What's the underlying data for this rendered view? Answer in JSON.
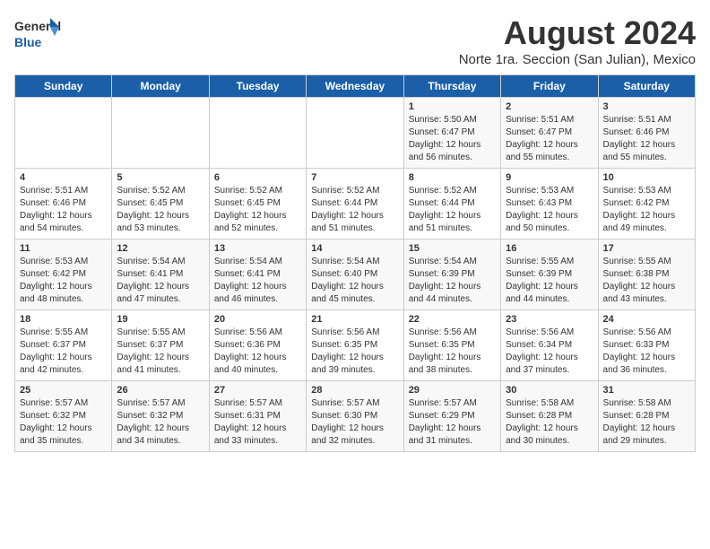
{
  "header": {
    "logo_line1": "General",
    "logo_line2": "Blue",
    "title": "August 2024",
    "subtitle": "Norte 1ra. Seccion (San Julian), Mexico"
  },
  "weekdays": [
    "Sunday",
    "Monday",
    "Tuesday",
    "Wednesday",
    "Thursday",
    "Friday",
    "Saturday"
  ],
  "weeks": [
    [
      {
        "day": "",
        "info": ""
      },
      {
        "day": "",
        "info": ""
      },
      {
        "day": "",
        "info": ""
      },
      {
        "day": "",
        "info": ""
      },
      {
        "day": "1",
        "info": "Sunrise: 5:50 AM\nSunset: 6:47 PM\nDaylight: 12 hours\nand 56 minutes."
      },
      {
        "day": "2",
        "info": "Sunrise: 5:51 AM\nSunset: 6:47 PM\nDaylight: 12 hours\nand 55 minutes."
      },
      {
        "day": "3",
        "info": "Sunrise: 5:51 AM\nSunset: 6:46 PM\nDaylight: 12 hours\nand 55 minutes."
      }
    ],
    [
      {
        "day": "4",
        "info": "Sunrise: 5:51 AM\nSunset: 6:46 PM\nDaylight: 12 hours\nand 54 minutes."
      },
      {
        "day": "5",
        "info": "Sunrise: 5:52 AM\nSunset: 6:45 PM\nDaylight: 12 hours\nand 53 minutes."
      },
      {
        "day": "6",
        "info": "Sunrise: 5:52 AM\nSunset: 6:45 PM\nDaylight: 12 hours\nand 52 minutes."
      },
      {
        "day": "7",
        "info": "Sunrise: 5:52 AM\nSunset: 6:44 PM\nDaylight: 12 hours\nand 51 minutes."
      },
      {
        "day": "8",
        "info": "Sunrise: 5:52 AM\nSunset: 6:44 PM\nDaylight: 12 hours\nand 51 minutes."
      },
      {
        "day": "9",
        "info": "Sunrise: 5:53 AM\nSunset: 6:43 PM\nDaylight: 12 hours\nand 50 minutes."
      },
      {
        "day": "10",
        "info": "Sunrise: 5:53 AM\nSunset: 6:42 PM\nDaylight: 12 hours\nand 49 minutes."
      }
    ],
    [
      {
        "day": "11",
        "info": "Sunrise: 5:53 AM\nSunset: 6:42 PM\nDaylight: 12 hours\nand 48 minutes."
      },
      {
        "day": "12",
        "info": "Sunrise: 5:54 AM\nSunset: 6:41 PM\nDaylight: 12 hours\nand 47 minutes."
      },
      {
        "day": "13",
        "info": "Sunrise: 5:54 AM\nSunset: 6:41 PM\nDaylight: 12 hours\nand 46 minutes."
      },
      {
        "day": "14",
        "info": "Sunrise: 5:54 AM\nSunset: 6:40 PM\nDaylight: 12 hours\nand 45 minutes."
      },
      {
        "day": "15",
        "info": "Sunrise: 5:54 AM\nSunset: 6:39 PM\nDaylight: 12 hours\nand 44 minutes."
      },
      {
        "day": "16",
        "info": "Sunrise: 5:55 AM\nSunset: 6:39 PM\nDaylight: 12 hours\nand 44 minutes."
      },
      {
        "day": "17",
        "info": "Sunrise: 5:55 AM\nSunset: 6:38 PM\nDaylight: 12 hours\nand 43 minutes."
      }
    ],
    [
      {
        "day": "18",
        "info": "Sunrise: 5:55 AM\nSunset: 6:37 PM\nDaylight: 12 hours\nand 42 minutes."
      },
      {
        "day": "19",
        "info": "Sunrise: 5:55 AM\nSunset: 6:37 PM\nDaylight: 12 hours\nand 41 minutes."
      },
      {
        "day": "20",
        "info": "Sunrise: 5:56 AM\nSunset: 6:36 PM\nDaylight: 12 hours\nand 40 minutes."
      },
      {
        "day": "21",
        "info": "Sunrise: 5:56 AM\nSunset: 6:35 PM\nDaylight: 12 hours\nand 39 minutes."
      },
      {
        "day": "22",
        "info": "Sunrise: 5:56 AM\nSunset: 6:35 PM\nDaylight: 12 hours\nand 38 minutes."
      },
      {
        "day": "23",
        "info": "Sunrise: 5:56 AM\nSunset: 6:34 PM\nDaylight: 12 hours\nand 37 minutes."
      },
      {
        "day": "24",
        "info": "Sunrise: 5:56 AM\nSunset: 6:33 PM\nDaylight: 12 hours\nand 36 minutes."
      }
    ],
    [
      {
        "day": "25",
        "info": "Sunrise: 5:57 AM\nSunset: 6:32 PM\nDaylight: 12 hours\nand 35 minutes."
      },
      {
        "day": "26",
        "info": "Sunrise: 5:57 AM\nSunset: 6:32 PM\nDaylight: 12 hours\nand 34 minutes."
      },
      {
        "day": "27",
        "info": "Sunrise: 5:57 AM\nSunset: 6:31 PM\nDaylight: 12 hours\nand 33 minutes."
      },
      {
        "day": "28",
        "info": "Sunrise: 5:57 AM\nSunset: 6:30 PM\nDaylight: 12 hours\nand 32 minutes."
      },
      {
        "day": "29",
        "info": "Sunrise: 5:57 AM\nSunset: 6:29 PM\nDaylight: 12 hours\nand 31 minutes."
      },
      {
        "day": "30",
        "info": "Sunrise: 5:58 AM\nSunset: 6:28 PM\nDaylight: 12 hours\nand 30 minutes."
      },
      {
        "day": "31",
        "info": "Sunrise: 5:58 AM\nSunset: 6:28 PM\nDaylight: 12 hours\nand 29 minutes."
      }
    ]
  ]
}
